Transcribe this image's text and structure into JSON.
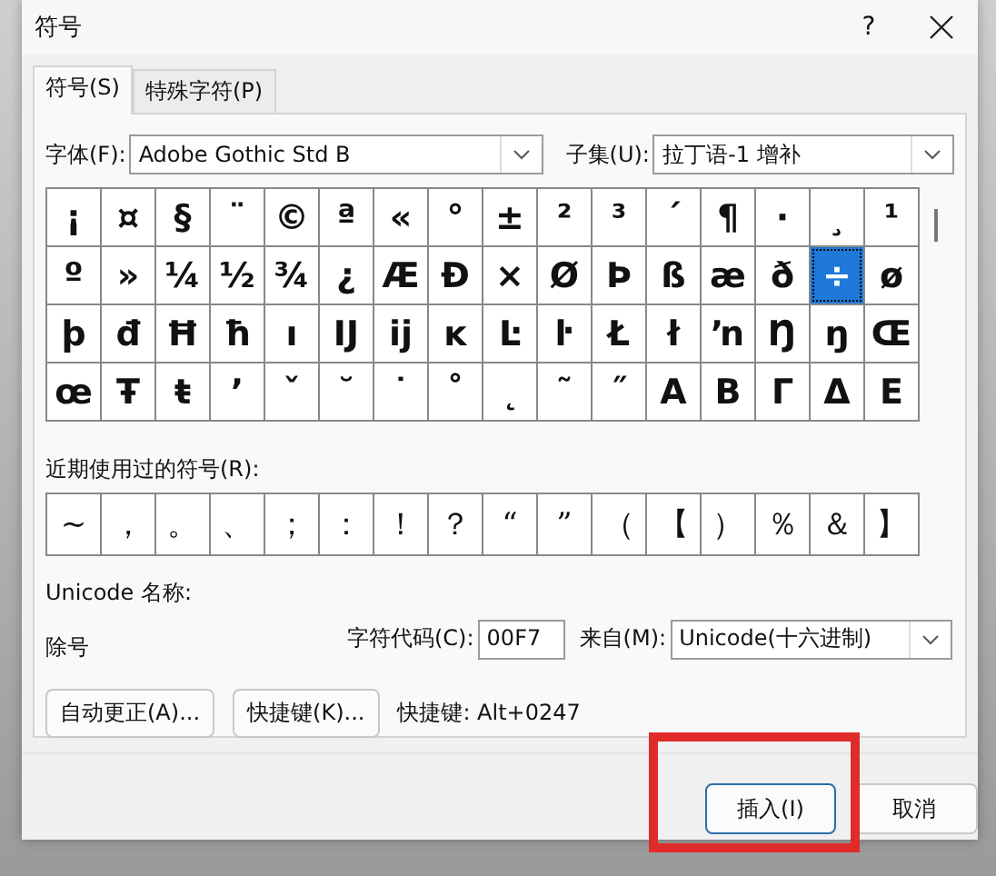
{
  "window": {
    "title": "符号",
    "help": "?"
  },
  "tabs": [
    {
      "label": "符号(S)",
      "selected": true
    },
    {
      "label": "特殊字符(P)",
      "selected": false
    }
  ],
  "font": {
    "label": "字体(F):",
    "value": "Adobe Gothic Std B"
  },
  "subset": {
    "label": "子集(U):",
    "value": "拉丁语-1 增补"
  },
  "symbols": [
    {
      "char": "¡",
      "selected": false
    },
    {
      "char": "¤",
      "selected": false
    },
    {
      "char": "§",
      "selected": false
    },
    {
      "char": "¨",
      "selected": false
    },
    {
      "char": "©",
      "selected": false
    },
    {
      "char": "ª",
      "selected": false
    },
    {
      "char": "«",
      "selected": false
    },
    {
      "char": "°",
      "selected": false
    },
    {
      "char": "±",
      "selected": false
    },
    {
      "char": "²",
      "selected": false
    },
    {
      "char": "³",
      "selected": false
    },
    {
      "char": "´",
      "selected": false
    },
    {
      "char": "¶",
      "selected": false
    },
    {
      "char": "·",
      "selected": false
    },
    {
      "char": "¸",
      "selected": false
    },
    {
      "char": "¹",
      "selected": false
    },
    {
      "char": "º",
      "selected": false
    },
    {
      "char": "»",
      "selected": false
    },
    {
      "char": "¼",
      "selected": false
    },
    {
      "char": "½",
      "selected": false
    },
    {
      "char": "¾",
      "selected": false
    },
    {
      "char": "¿",
      "selected": false
    },
    {
      "char": "Æ",
      "selected": false
    },
    {
      "char": "Ð",
      "selected": false
    },
    {
      "char": "×",
      "selected": false
    },
    {
      "char": "Ø",
      "selected": false
    },
    {
      "char": "Þ",
      "selected": false
    },
    {
      "char": "ß",
      "selected": false
    },
    {
      "char": "æ",
      "selected": false
    },
    {
      "char": "ð",
      "selected": false
    },
    {
      "char": "÷",
      "selected": true
    },
    {
      "char": "ø",
      "selected": false
    },
    {
      "char": "þ",
      "selected": false
    },
    {
      "char": "đ",
      "selected": false
    },
    {
      "char": "Ħ",
      "selected": false
    },
    {
      "char": "ħ",
      "selected": false
    },
    {
      "char": "ı",
      "selected": false
    },
    {
      "char": "Ĳ",
      "selected": false
    },
    {
      "char": "ĳ",
      "selected": false
    },
    {
      "char": "ĸ",
      "selected": false
    },
    {
      "char": "Ŀ",
      "selected": false
    },
    {
      "char": "ŀ",
      "selected": false
    },
    {
      "char": "Ł",
      "selected": false
    },
    {
      "char": "ł",
      "selected": false
    },
    {
      "char": "ŉ",
      "selected": false
    },
    {
      "char": "Ŋ",
      "selected": false
    },
    {
      "char": "ŋ",
      "selected": false
    },
    {
      "char": "Œ",
      "selected": false
    },
    {
      "char": "œ",
      "selected": false
    },
    {
      "char": "Ŧ",
      "selected": false
    },
    {
      "char": "ŧ",
      "selected": false
    },
    {
      "char": "ʼ",
      "selected": false
    },
    {
      "char": "ˇ",
      "selected": false
    },
    {
      "char": "˘",
      "selected": false
    },
    {
      "char": "˙",
      "selected": false
    },
    {
      "char": "˚",
      "selected": false
    },
    {
      "char": "˛",
      "selected": false
    },
    {
      "char": "˜",
      "selected": false
    },
    {
      "char": "˝",
      "selected": false
    },
    {
      "char": "Α",
      "selected": false
    },
    {
      "char": "Β",
      "selected": false
    },
    {
      "char": "Γ",
      "selected": false
    },
    {
      "char": "Δ",
      "selected": false
    },
    {
      "char": "Ε",
      "selected": false
    }
  ],
  "recent": {
    "label": "近期使用过的符号(R):",
    "symbols": [
      "~",
      "，",
      "。",
      "、",
      "；",
      "：",
      "！",
      "？",
      "“",
      "”",
      "（",
      "【",
      "）",
      "％",
      "＆",
      "】"
    ]
  },
  "unicode_name": {
    "label": "Unicode 名称:",
    "value": "除号"
  },
  "char_code": {
    "label": "字符代码(C):",
    "value": "00F7"
  },
  "from": {
    "label": "来自(M):",
    "value": "Unicode(十六进制)"
  },
  "autocorrect_button": "自动更正(A)...",
  "shortcut_button": "快捷键(K)...",
  "shortcut_text": "快捷键: Alt+0247",
  "insert_button": {
    "label": "插入(I)",
    "highlighted": true
  },
  "cancel_button": "取消"
}
